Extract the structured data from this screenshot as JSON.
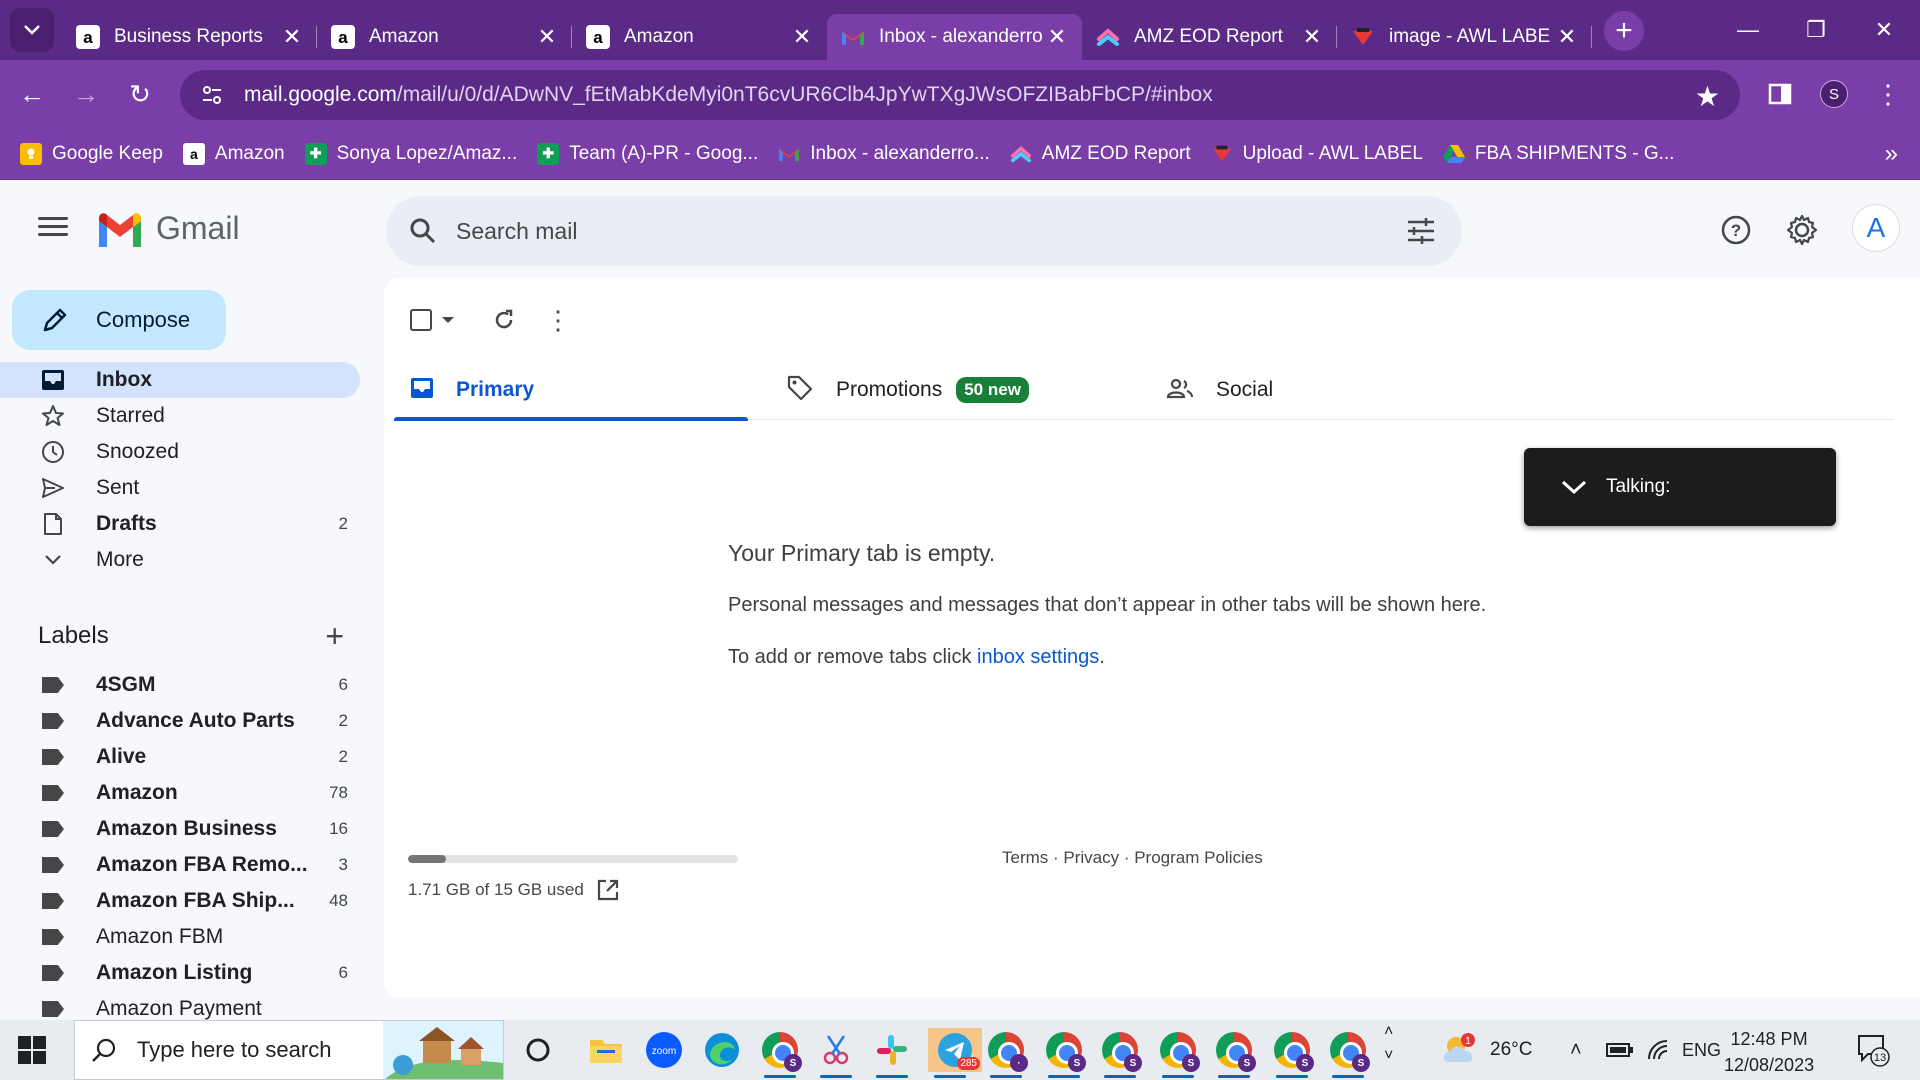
{
  "browser": {
    "tabs": [
      {
        "title": "Business Reports",
        "icon": "amazon-icon"
      },
      {
        "title": "Amazon",
        "icon": "amazon-icon"
      },
      {
        "title": "Amazon",
        "icon": "amazon-icon"
      },
      {
        "title": "Inbox - alexanderro",
        "icon": "gmail-icon",
        "active": true
      },
      {
        "title": "AMZ EOD Report",
        "icon": "clickup-icon"
      },
      {
        "title": "image - AWL LABE",
        "icon": "awl-icon"
      }
    ],
    "url_host": "mail.google.com",
    "url_path": "/mail/u/0/d/ADwNV_fEtMabKdeMyi0nT6cvUR6Clb4JpYwTXgJWsOFZIBabFbCP/#inbox",
    "profile_initial": "S",
    "bookmarks": [
      {
        "label": "Google Keep",
        "icon": "keep-icon"
      },
      {
        "label": "Amazon",
        "icon": "amazon-icon"
      },
      {
        "label": "Sonya Lopez/Amaz...",
        "icon": "sheets-icon"
      },
      {
        "label": "Team (A)-PR - Goog...",
        "icon": "sheets-icon"
      },
      {
        "label": "Inbox - alexanderro...",
        "icon": "gmail-icon"
      },
      {
        "label": "AMZ EOD Report",
        "icon": "clickup-icon"
      },
      {
        "label": "Upload - AWL LABEL",
        "icon": "awl-icon"
      },
      {
        "label": "FBA SHIPMENTS - G...",
        "icon": "drive-icon"
      }
    ]
  },
  "gmail": {
    "logo_text": "Gmail",
    "search_placeholder": "Search mail",
    "avatar_initial": "A",
    "compose_label": "Compose",
    "nav": [
      {
        "label": "Inbox",
        "count": "",
        "icon": "inbox-icon",
        "active": true,
        "bold": true
      },
      {
        "label": "Starred",
        "count": "",
        "icon": "star-icon"
      },
      {
        "label": "Snoozed",
        "count": "",
        "icon": "clock-icon"
      },
      {
        "label": "Sent",
        "count": "",
        "icon": "send-icon"
      },
      {
        "label": "Drafts",
        "count": "2",
        "icon": "draft-icon",
        "bold": true
      },
      {
        "label": "More",
        "count": "",
        "icon": "chevron-down-icon"
      }
    ],
    "labels_title": "Labels",
    "labels": [
      {
        "name": "4SGM",
        "count": "6",
        "bold": true
      },
      {
        "name": "Advance Auto Parts",
        "count": "2",
        "bold": true
      },
      {
        "name": "Alive",
        "count": "2",
        "bold": true
      },
      {
        "name": "Amazon",
        "count": "78",
        "bold": true
      },
      {
        "name": "Amazon Business",
        "count": "16",
        "bold": true
      },
      {
        "name": "Amazon FBA Remo...",
        "count": "3",
        "bold": true
      },
      {
        "name": "Amazon FBA Ship...",
        "count": "48",
        "bold": true
      },
      {
        "name": "Amazon FBM",
        "count": "",
        "bold": false
      },
      {
        "name": "Amazon Listing",
        "count": "6",
        "bold": true
      },
      {
        "name": "Amazon Payment",
        "count": "",
        "bold": false
      }
    ],
    "tabs": [
      {
        "label": "Primary",
        "icon": "inbox-tab-icon",
        "active": true
      },
      {
        "label": "Promotions",
        "icon": "tag-icon",
        "badge": "50 new"
      },
      {
        "label": "Social",
        "icon": "people-icon"
      }
    ],
    "empty_title": "Your Primary tab is empty.",
    "empty_desc": "Personal messages and messages that don’t appear in other tabs will be shown here.",
    "empty_hint_prefix": "To add or remove tabs click ",
    "empty_hint_link": "inbox settings",
    "empty_hint_suffix": ".",
    "storage_text": "1.71 GB of 15 GB used",
    "storage_fraction": 0.114,
    "footer_links": "Terms · Privacy · Program Policies"
  },
  "overlay": {
    "talking_label": "Talking:"
  },
  "taskbar": {
    "search_placeholder": "Type here to search",
    "telegram_badge": "285",
    "weather_temp": "26°C",
    "weather_badge": "1",
    "language": "ENG",
    "time": "12:48 PM",
    "date": "12/08/2023",
    "notifications": "13"
  },
  "colors": {
    "chrome_dark": "#5b2a86",
    "chrome_light": "#7a3ea8",
    "gmail_blue": "#0b57d0",
    "compose_bg": "#c2e7ff",
    "promo_green": "#188038"
  }
}
